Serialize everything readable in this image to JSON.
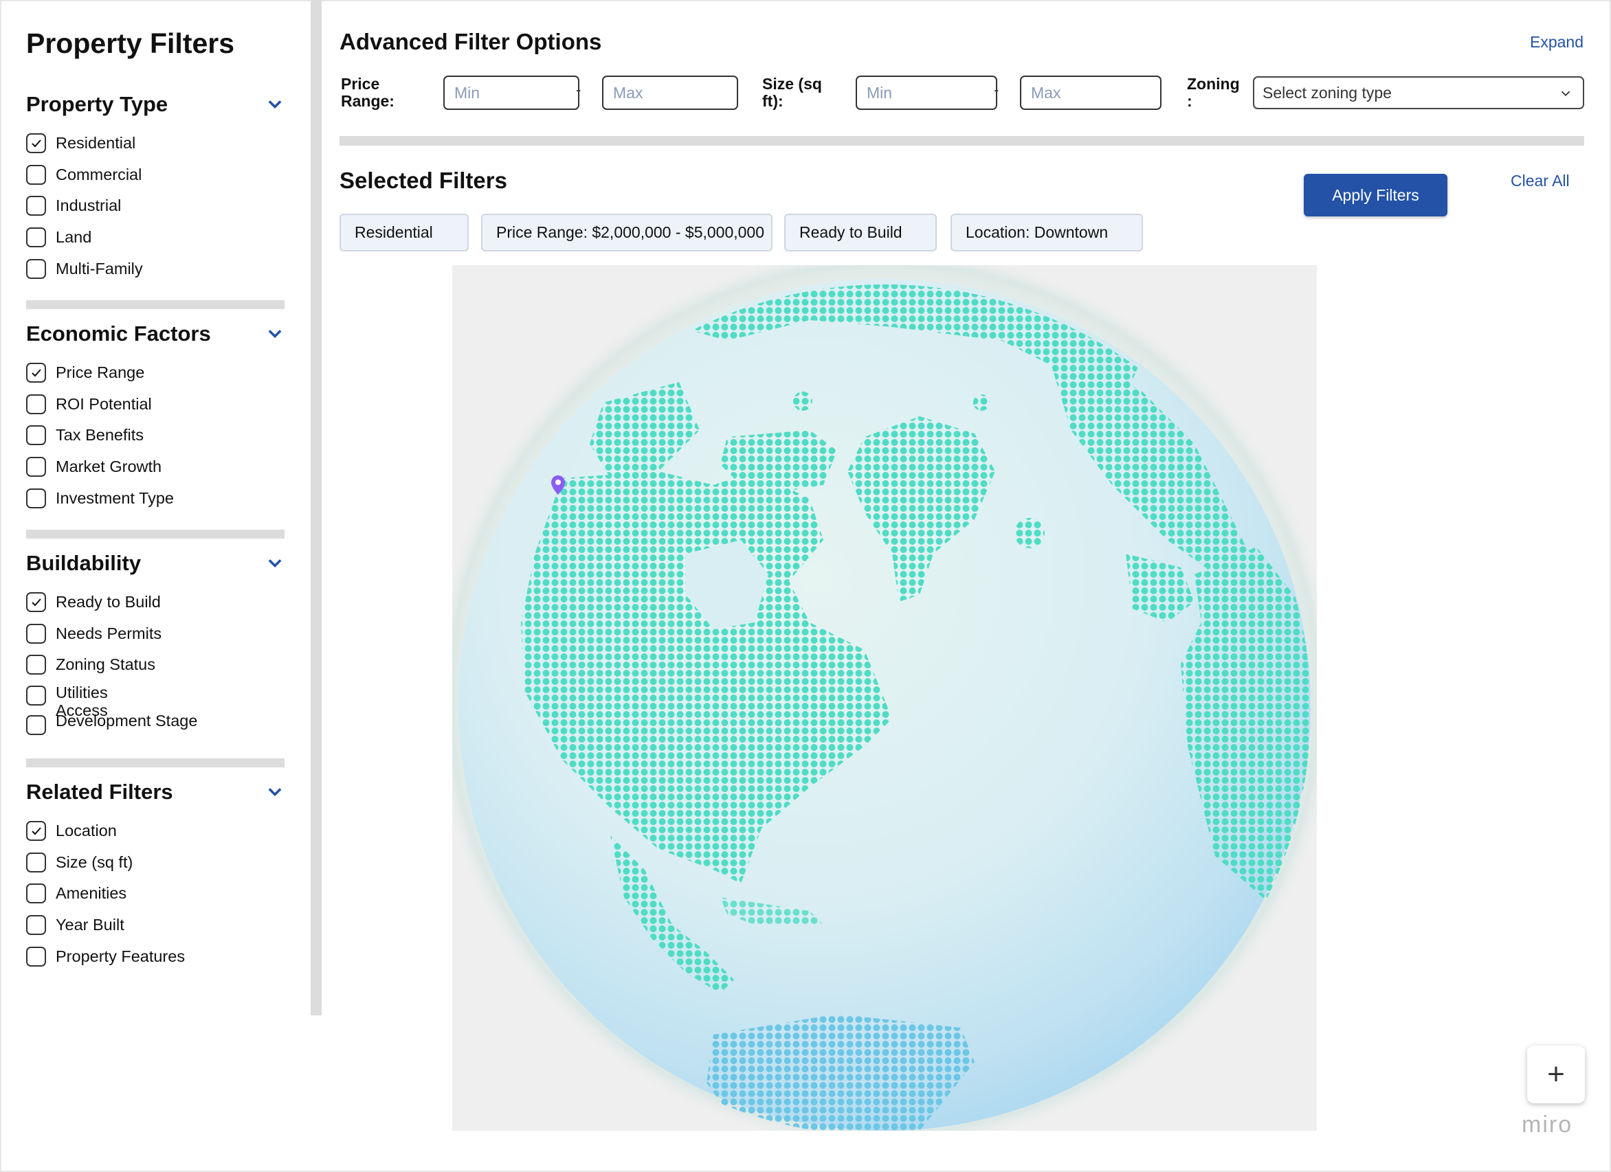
{
  "sidebar": {
    "title": "Property Filters",
    "sections": [
      {
        "title": "Property Type",
        "options": [
          {
            "label": "Residential",
            "checked": true
          },
          {
            "label": "Commercial",
            "checked": false
          },
          {
            "label": "Industrial",
            "checked": false
          },
          {
            "label": "Land",
            "checked": false
          },
          {
            "label": "Multi-Family",
            "checked": false
          }
        ]
      },
      {
        "title": "Economic Factors",
        "options": [
          {
            "label": "Price Range",
            "checked": true
          },
          {
            "label": "ROI Potential",
            "checked": false
          },
          {
            "label": "Tax Benefits",
            "checked": false
          },
          {
            "label": "Market Growth",
            "checked": false
          },
          {
            "label": "Investment Type",
            "checked": false
          }
        ]
      },
      {
        "title": "Buildability",
        "options": [
          {
            "label": "Ready to Build",
            "checked": true
          },
          {
            "label": "Needs Permits",
            "checked": false
          },
          {
            "label": "Zoning Status",
            "checked": false
          },
          {
            "label": "Utilities Access",
            "checked": false
          },
          {
            "label": "Development Stage",
            "checked": false
          }
        ]
      },
      {
        "title": "Related Filters",
        "options": [
          {
            "label": "Location",
            "checked": true
          },
          {
            "label": "Size (sq ft)",
            "checked": false
          },
          {
            "label": "Amenities",
            "checked": false
          },
          {
            "label": "Year Built",
            "checked": false
          },
          {
            "label": "Property Features",
            "checked": false
          }
        ]
      }
    ]
  },
  "advanced": {
    "title": "Advanced Filter Options",
    "expand_label": "Expand",
    "price_label": "Price Range:",
    "price_min_placeholder": "Min",
    "price_max_placeholder": "Max",
    "size_label": "Size (sq ft):",
    "size_min_placeholder": "Min",
    "size_max_placeholder": "Max",
    "zoning_label": "Zoning :",
    "zoning_placeholder": "Select zoning type"
  },
  "selected": {
    "title": "Selected Filters",
    "apply_label": "Apply Filters",
    "clear_label": "Clear All",
    "chips": [
      "Residential",
      "Price Range: $2,000,000 - $5,000,000",
      "Ready to Build",
      "Location: Downtown"
    ]
  },
  "globe": {
    "land_color": "#4fdcc4",
    "ocean_color": "#d6ecf2",
    "marker_color": "#8b5cf6"
  },
  "zoom": {
    "label": "+"
  },
  "watermark": "miro"
}
